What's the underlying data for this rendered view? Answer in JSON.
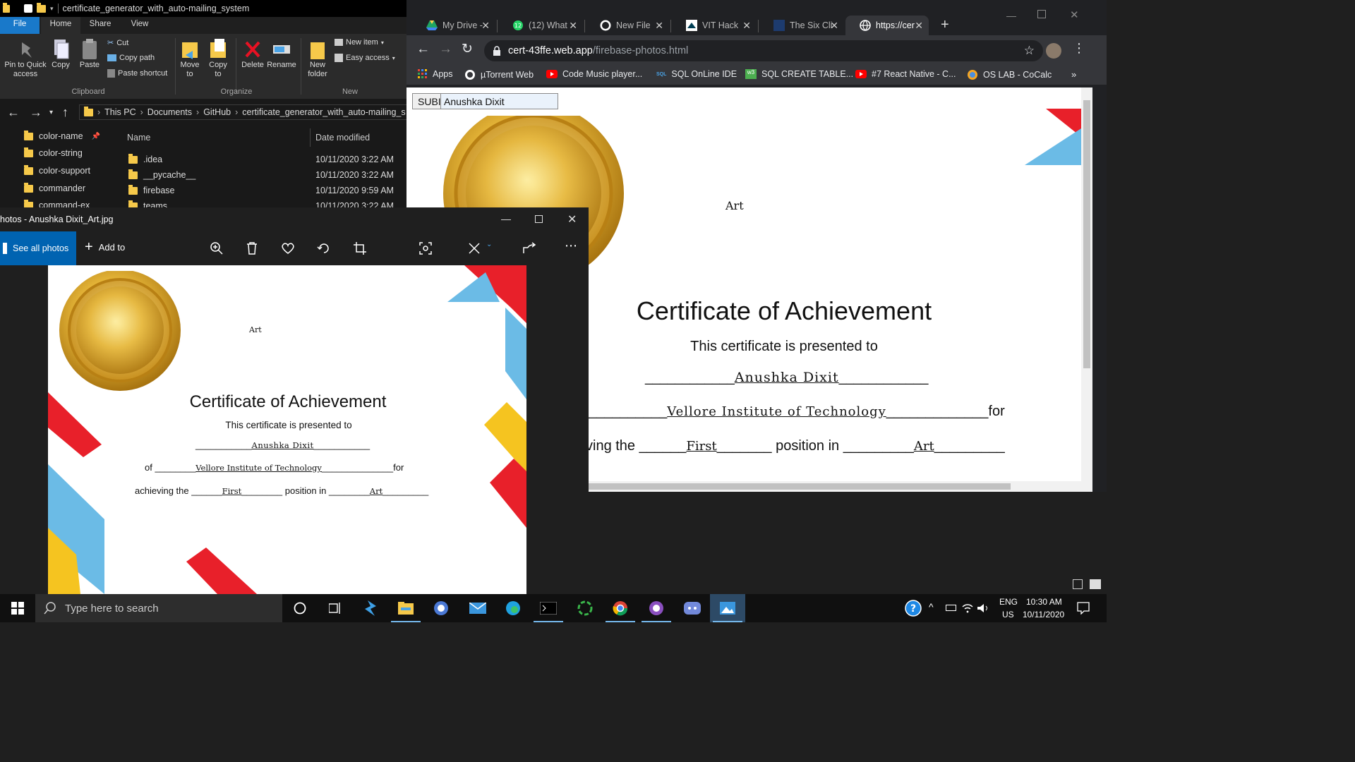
{
  "explorer": {
    "title": "certificate_generator_with_auto-mailing_system",
    "menu": [
      "File",
      "Home",
      "Share",
      "View"
    ],
    "ribbon": {
      "pin": "Pin to Quick access",
      "copy": "Copy",
      "paste": "Paste",
      "cut": "Cut",
      "copy_path": "Copy path",
      "paste_shortcut": "Paste shortcut",
      "move_to": "Move to",
      "copy_to": "Copy to",
      "delete": "Delete",
      "rename": "Rename",
      "new_folder": "New folder",
      "new_item": "New item",
      "easy_access": "Easy access",
      "groups": [
        "Clipboard",
        "Organize",
        "New"
      ]
    },
    "breadcrumb": [
      "This PC",
      "Documents",
      "GitHub",
      "certificate_generator_with_auto-mailing_s"
    ],
    "nav_items": [
      "color-name",
      "color-string",
      "color-support",
      "commander",
      "command-ex"
    ],
    "columns": {
      "name": "Name",
      "date": "Date modified"
    },
    "files": [
      {
        "name": ".idea",
        "date": "10/11/2020 3:22 AM"
      },
      {
        "name": "__pycache__",
        "date": "10/11/2020 3:22 AM"
      },
      {
        "name": "firebase",
        "date": "10/11/2020 9:59 AM"
      },
      {
        "name": "teams",
        "date": "10/11/2020 3:22 AM"
      }
    ]
  },
  "chrome": {
    "tabs": [
      {
        "title": "My Drive -",
        "icon": "google-drive-icon"
      },
      {
        "title": "(12) What",
        "icon": "whatsapp-icon"
      },
      {
        "title": "New File",
        "icon": "github-icon"
      },
      {
        "title": "VIT Hack",
        "icon": "devpost-icon"
      },
      {
        "title": "The Six Cli",
        "icon": "page-icon"
      },
      {
        "title": "https://cer",
        "icon": "globe-icon"
      }
    ],
    "url_host": "cert-43ffe.web.app",
    "url_path": "/firebase-photos.html",
    "bookmarks": [
      "Apps",
      "µTorrent Web",
      "Code Music player...",
      "SQL OnLine IDE",
      "SQL CREATE TABLE...",
      "#7 React Native - C...",
      "OS LAB - CoCalc"
    ],
    "input_button": "SUBI",
    "input_value": "Anushka Dixit"
  },
  "certificate": {
    "category": "Art",
    "title": "Certificate of Achievement",
    "presented": "This certificate is presented to",
    "name": "Anushka Dixit",
    "of": "of",
    "institute": "Vellore Institute of Technology",
    "for": "for",
    "achieving_the": "achieving the",
    "position": "First",
    "position_in": "position in",
    "event": "Art",
    "partial_achieving": "ving the"
  },
  "photos": {
    "title": "hotos - Anushka Dixit_Art.jpg",
    "see_all": "See all photos",
    "add_to": "Add to"
  },
  "taskbar": {
    "search_placeholder": "Type here to search",
    "lang": "ENG",
    "region": "US",
    "time": "10:30 AM",
    "date": "10/11/2020"
  },
  "colors": {
    "accent": "#0063b1",
    "red": "#e8202a",
    "blue": "#6bbbe6",
    "yellow": "#f5c420",
    "gold": "#e2b13a"
  }
}
